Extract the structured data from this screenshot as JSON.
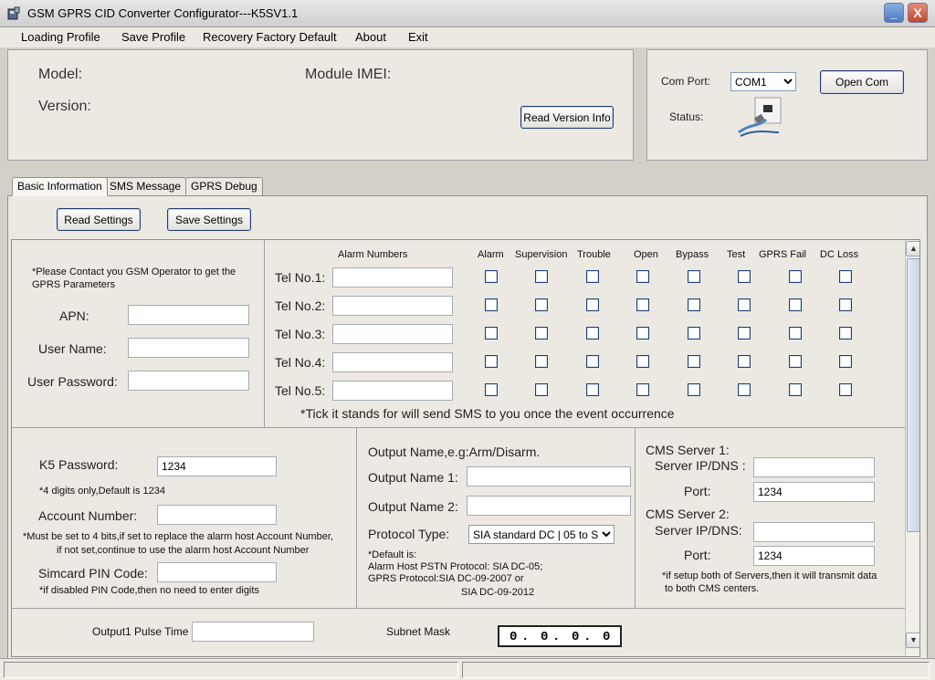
{
  "window": {
    "title": "GSM GPRS CID Converter Configurator---K5SV1.1",
    "minimize_symbol": "_",
    "close_symbol": "X"
  },
  "menu": {
    "loading_profile": "Loading Profile",
    "save_profile": "Save Profile",
    "recovery_default": "Recovery Factory Default",
    "about": "About",
    "exit": "Exit"
  },
  "device_info": {
    "model_label": "Model:",
    "version_label": "Version:",
    "imei_label": "Module IMEI:",
    "read_version_button": "Read Version Info"
  },
  "com": {
    "port_label": "Com Port:",
    "port_value": "COM1",
    "status_label": "Status:",
    "open_button": "Open Com",
    "status_icon": "disconnected-plug-icon"
  },
  "tabs": [
    "Basic Information",
    "SMS Message",
    "GPRS Debug"
  ],
  "toolbar": {
    "read_settings": "Read Settings",
    "save_settings": "Save Settings"
  },
  "gprs": {
    "note": "*Please Contact you GSM Operator to get the GPRS Parameters",
    "apn_label": "APN:",
    "apn_value": "",
    "user_name_label": "User Name:",
    "user_name_value": "",
    "user_password_label": "User Password:",
    "user_password_value": ""
  },
  "alarm_numbers": {
    "header": "Alarm Numbers",
    "columns": [
      "Alarm",
      "Supervision",
      "Trouble",
      "Open",
      "Bypass",
      "Test",
      "GPRS Fail",
      "DC Loss"
    ],
    "rows": [
      {
        "label": "Tel No.1:",
        "value": ""
      },
      {
        "label": "Tel No.2:",
        "value": ""
      },
      {
        "label": "Tel No.3:",
        "value": ""
      },
      {
        "label": "Tel No.4:",
        "value": ""
      },
      {
        "label": "Tel No.5:",
        "value": ""
      }
    ],
    "note": "*Tick it stands for will send SMS to you once the event occurrence"
  },
  "account": {
    "k5_password_label": "K5 Password:",
    "k5_password_value": "1234",
    "k5_password_note": "*4 digits only,Default is 1234",
    "account_number_label": "Account Number:",
    "account_number_value": "",
    "account_note_1": "*Must be set to 4 bits,if set to replace the alarm host Account Number,",
    "account_note_2": "if not set,continue to use the alarm host Account Number",
    "pin_label": "Simcard PIN Code:",
    "pin_value": "",
    "pin_note": "*if disabled PIN Code,then no need to enter digits"
  },
  "output": {
    "header": "Output Name,e.g:Arm/Disarm.",
    "name1_label": "Output Name 1:",
    "name1_value": "",
    "name2_label": "Output Name 2:",
    "name2_value": "",
    "protocol_label": "Protocol Type:",
    "protocol_value": "SIA standard DC | 05 to S",
    "default_note_1": "*Default is:",
    "default_note_2": "Alarm Host PSTN Protocol: SIA DC-05;",
    "default_note_3": "GPRS Protocol:SIA DC-09-2007 or",
    "default_note_4": "SIA DC-09-2012"
  },
  "cms": {
    "server1_label": "CMS Server 1:",
    "server1_ip_label": "Server IP/DNS :",
    "server1_ip_value": "",
    "server1_port_label": "Port:",
    "server1_port_value": "1234",
    "server2_label": "CMS Server 2:",
    "server2_ip_label": "Server IP/DNS:",
    "server2_ip_value": "",
    "server2_port_label": "Port:",
    "server2_port_value": "1234",
    "note_1": "*if setup both of Servers,then it will transmit data",
    "note_2": "to both CMS centers."
  },
  "bottom": {
    "pulse_label": "Output1 Pulse Time",
    "pulse_value": "",
    "subnet_label": "Subnet Mask",
    "subnet_value": [
      "0",
      "0",
      "0",
      "0"
    ]
  },
  "scrollbar": {
    "up": "▲",
    "down": "▼"
  }
}
